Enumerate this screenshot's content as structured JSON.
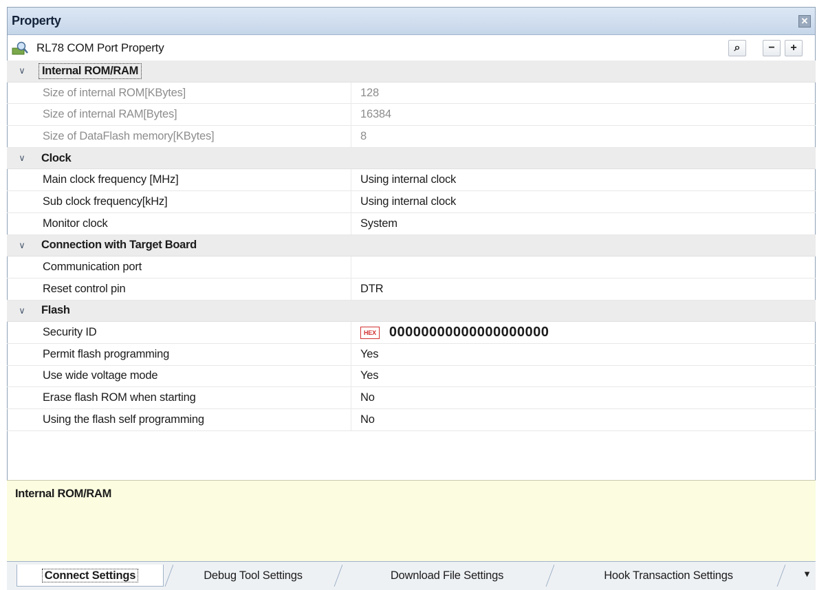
{
  "panel": {
    "title": "Property"
  },
  "toolbar": {
    "object_name": "RL78 COM Port Property",
    "search_label": "⌕",
    "collapse_label": "−",
    "expand_label": "+"
  },
  "groups": {
    "internal": {
      "label": "Internal ROM/RAM",
      "rows": [
        {
          "name": "Size of internal ROM[KBytes]",
          "value": "128"
        },
        {
          "name": "Size of internal RAM[Bytes]",
          "value": "16384"
        },
        {
          "name": "Size of DataFlash memory[KBytes]",
          "value": "8"
        }
      ]
    },
    "clock": {
      "label": "Clock",
      "rows": [
        {
          "name": "Main clock frequency [MHz]",
          "value": "Using internal clock"
        },
        {
          "name": "Sub clock frequency[kHz]",
          "value": "Using internal clock"
        },
        {
          "name": "Monitor clock",
          "value": "System"
        }
      ]
    },
    "connection": {
      "label": "Connection with Target Board",
      "rows": [
        {
          "name": "Communication port",
          "value": ""
        },
        {
          "name": "Reset control pin",
          "value": "DTR"
        }
      ]
    },
    "flash": {
      "label": "Flash",
      "rows": [
        {
          "name": "Security ID",
          "value": "00000000000000000000",
          "badge": "HEX"
        },
        {
          "name": "Permit flash programming",
          "value": "Yes"
        },
        {
          "name": "Use wide voltage mode",
          "value": "Yes"
        },
        {
          "name": "Erase flash ROM when starting",
          "value": "No"
        },
        {
          "name": "Using the flash self programming",
          "value": "No"
        }
      ]
    }
  },
  "description": {
    "title": "Internal ROM/RAM"
  },
  "tabs": [
    "Connect Settings",
    "Debug Tool Settings",
    "Download File Settings",
    "Hook Transaction Settings"
  ],
  "icons": {
    "close": "close-icon",
    "property": "property-icon",
    "expand": "chevron-down-icon",
    "overflow": "overflow-arrow-icon"
  },
  "colors": {
    "description_bg": "#fcfce0",
    "hex_badge": "#d23030",
    "category_bg": "#ececec"
  }
}
